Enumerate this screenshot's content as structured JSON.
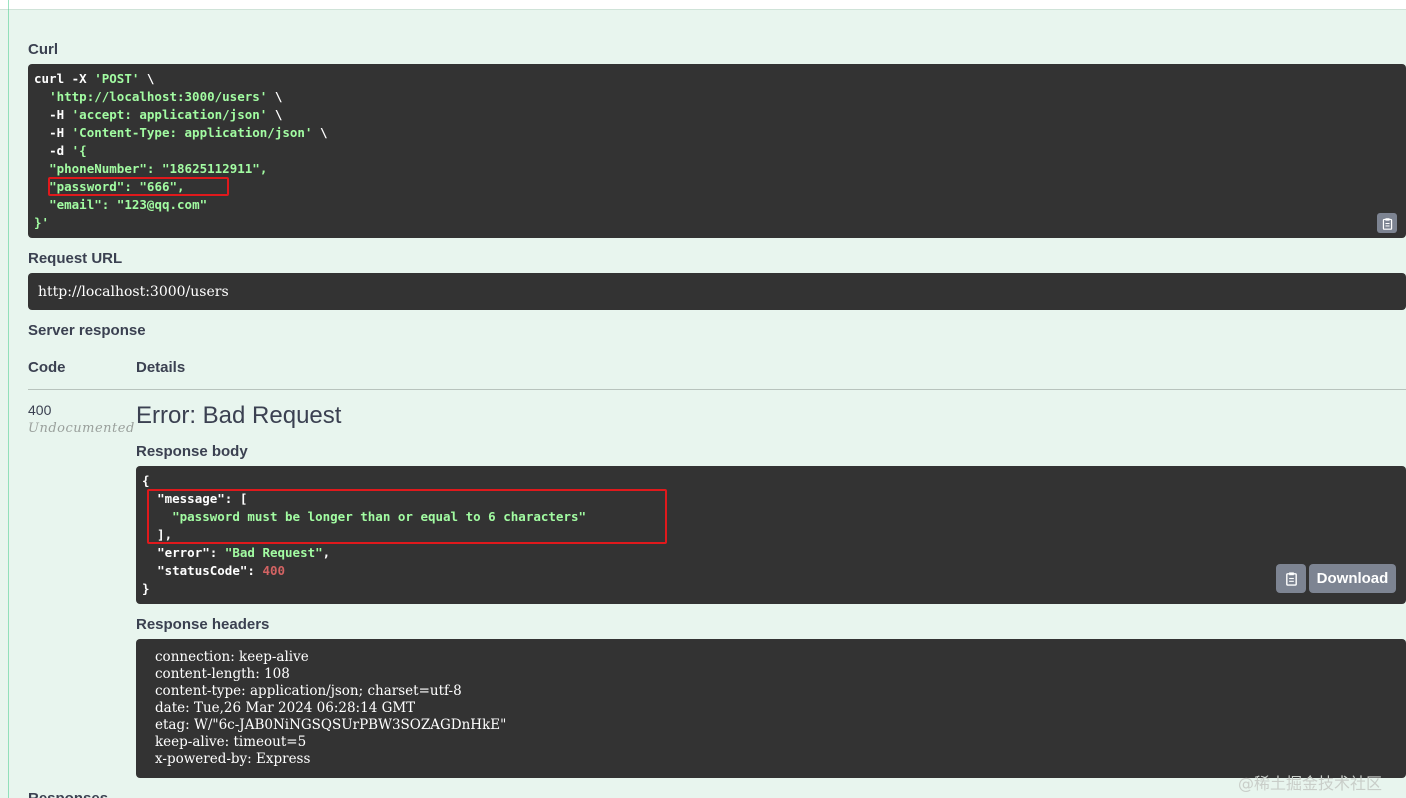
{
  "sections": {
    "curl": "Curl",
    "request_url": "Request URL",
    "server_response": "Server response",
    "code_header": "Code",
    "details_header": "Details",
    "response_body": "Response body",
    "response_headers": "Response headers",
    "responses": "Responses"
  },
  "curl": {
    "cmd": "curl -X ",
    "method": "'POST'",
    "cont": " \\",
    "url": "'http://localhost:3000/users'",
    "h1_flag": "-H ",
    "h1": "'accept: application/json'",
    "h2_flag": "-H ",
    "h2": "'Content-Type: application/json'",
    "d_flag": "-d ",
    "d_open": "'{",
    "phone_key": "\"phoneNumber\"",
    "phone_val": "\"18625112911\"",
    "pwd_key": "\"password\"",
    "pwd_val": "\"666\"",
    "email_key": "\"email\"",
    "email_val": "\"123@qq.com\"",
    "d_close": "}'"
  },
  "request_url": "http://localhost:3000/users",
  "response": {
    "code": "400",
    "undocumented": "Undocumented",
    "title": "Error: Bad Request",
    "body": {
      "open": "{",
      "message_key": "\"message\"",
      "message_val": "\"password must be longer than or equal to 6 characters\"",
      "error_key": "\"error\"",
      "error_val": "\"Bad Request\"",
      "status_key": "\"statusCode\"",
      "status_val": "400",
      "close": "}"
    },
    "download_label": "Download",
    "headers": [
      "connection: keep-alive",
      "content-length: 108",
      "content-type: application/json; charset=utf-8",
      "date: Tue,26 Mar 2024 06:28:14 GMT",
      "etag: W/\"6c-JAB0NiNGSQSUrPBW3SOZAGDnHkE\"",
      "keep-alive: timeout=5",
      "x-powered-by: Express"
    ]
  },
  "watermark": "@稀土掘金技术社区",
  "colors": {
    "code_bg": "#333333",
    "string": "#a2fca2",
    "number": "#d36363",
    "highlight": "#e0191c",
    "page_bg": "#e8f5ee"
  }
}
